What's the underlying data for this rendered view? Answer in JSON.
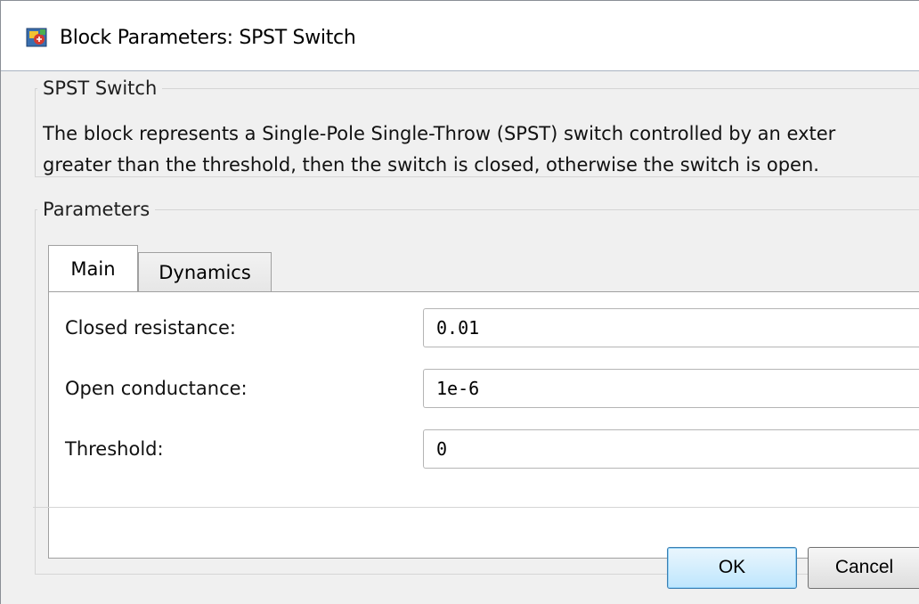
{
  "window": {
    "title": "Block Parameters: SPST Switch",
    "icon": "simulink-block-icon"
  },
  "block_group": {
    "legend": "SPST Switch",
    "description_line1": "The block represents a Single-Pole Single-Throw (SPST) switch controlled by an exter",
    "description_line2": "greater than the threshold, then the switch is closed, otherwise the switch is open."
  },
  "parameters_group": {
    "legend": "Parameters",
    "tabs": [
      {
        "label": "Main",
        "selected": true
      },
      {
        "label": "Dynamics",
        "selected": false
      }
    ],
    "fields": [
      {
        "label": "Closed resistance:",
        "value": "0.01"
      },
      {
        "label": "Open conductance:",
        "value": "1e-6"
      },
      {
        "label": "Threshold:",
        "value": "0"
      }
    ]
  },
  "buttons": {
    "ok": "OK",
    "cancel": "Cancel"
  },
  "colors": {
    "dialog_bg": "#f0f0f0",
    "ok_button_accent": "#3c7fb1"
  }
}
